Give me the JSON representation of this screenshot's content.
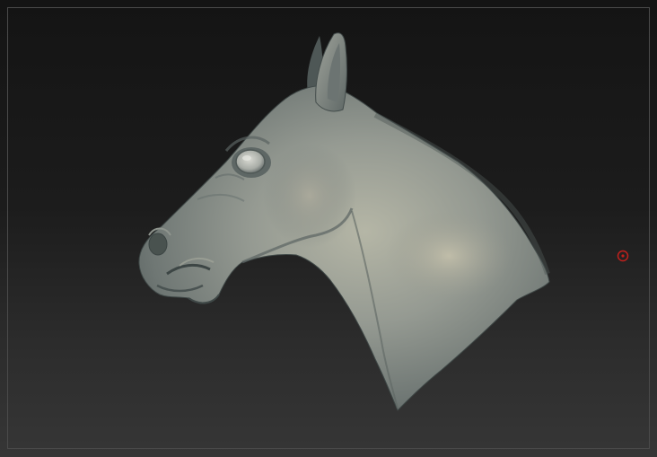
{
  "viewport": {
    "model": "horse-head-sculpt",
    "background_top": "#141414",
    "background_bottom": "#363636",
    "frame_color": "#4a4a4a",
    "material_color": "#8f968f",
    "cursor_color": "#c0201c",
    "icon": "circle-cursor-icon"
  }
}
